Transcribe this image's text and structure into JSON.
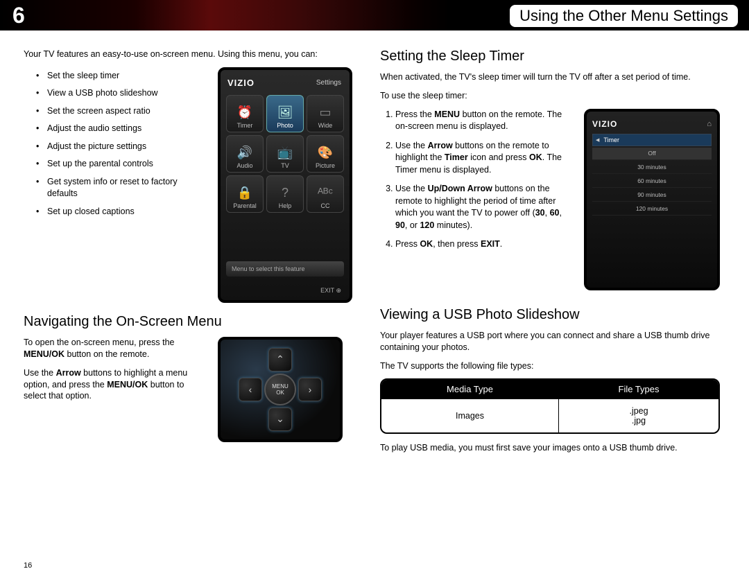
{
  "header": {
    "chapter_number": "6",
    "title": "Using the Other Menu Settings"
  },
  "left": {
    "intro": "Your TV features an easy-to-use on-screen menu. Using this menu, you can:",
    "features": [
      "Set the sleep timer",
      "View a USB photo slideshow",
      "Set the screen aspect ratio",
      "Adjust the audio settings",
      "Adjust the picture settings",
      "Set up the parental controls",
      "Get system info or reset to factory defaults",
      "Set up closed captions"
    ],
    "settings_screen": {
      "logo": "VIZIO",
      "heading": "Settings",
      "cells": [
        "Timer",
        "Photo",
        "Wide",
        "Audio",
        "TV",
        "Picture",
        "Parental",
        "Help",
        "CC"
      ],
      "hint": "Menu to select this feature",
      "exit": "EXIT"
    },
    "nav_heading": "Navigating the On-Screen Menu",
    "nav_p1_a": "To open the on-screen menu, press the ",
    "nav_p1_b": "MENU/OK",
    "nav_p1_c": " button on the remote.",
    "nav_p2_a": "Use the ",
    "nav_p2_b": "Arrow",
    "nav_p2_c": " buttons to highlight a menu option, and press the ",
    "nav_p2_d": "MENU/OK",
    "nav_p2_e": " button to select that option.",
    "dpad": {
      "center_line1": "MENU",
      "center_line2": "OK"
    }
  },
  "right": {
    "sleep_heading": "Setting the Sleep Timer",
    "sleep_intro": "When activated, the TV's sleep timer will turn the TV off after a set period of time.",
    "sleep_lead": "To use the sleep timer:",
    "steps": [
      {
        "pre": "Press the ",
        "b1": "MENU",
        "post": " button on the remote. The on-screen menu is displayed."
      },
      {
        "pre": "Use the ",
        "b1": "Arrow",
        "mid": " buttons on the remote to highlight the ",
        "b2": "Timer",
        "mid2": " icon and press ",
        "b3": "OK",
        "post": ". The Timer menu is displayed."
      },
      {
        "pre": "Use the ",
        "b1": "Up/Down Arrow",
        "mid": " buttons on the remote to highlight the period of time after which you want the TV to power off (",
        "b2": "30",
        "mid2": ", ",
        "b3": "60",
        "mid3": ", ",
        "b4": "90",
        "mid4": ", or ",
        "b5": "120",
        "post": " minutes)."
      },
      {
        "pre": "Press ",
        "b1": "OK",
        "mid": ", then press ",
        "b2": "EXIT",
        "post": "."
      }
    ],
    "timer_screen": {
      "logo": "VIZIO",
      "label": "Timer",
      "options": [
        "Off",
        "30 minutes",
        "60 minutes",
        "90 minutes",
        "120 minutes"
      ]
    },
    "usb_heading": "Viewing a USB Photo Slideshow",
    "usb_p1": "Your player features a USB port where you can connect and share a USB thumb drive containing your photos.",
    "usb_p2": "The TV supports the following file types:",
    "table": {
      "h1": "Media Type",
      "h2": "File Types",
      "r1c1": "Images",
      "r1c2a": ".jpeg",
      "r1c2b": ".jpg"
    },
    "usb_p3": "To play USB media, you must first save your images onto a USB thumb drive."
  },
  "page_number": "16"
}
